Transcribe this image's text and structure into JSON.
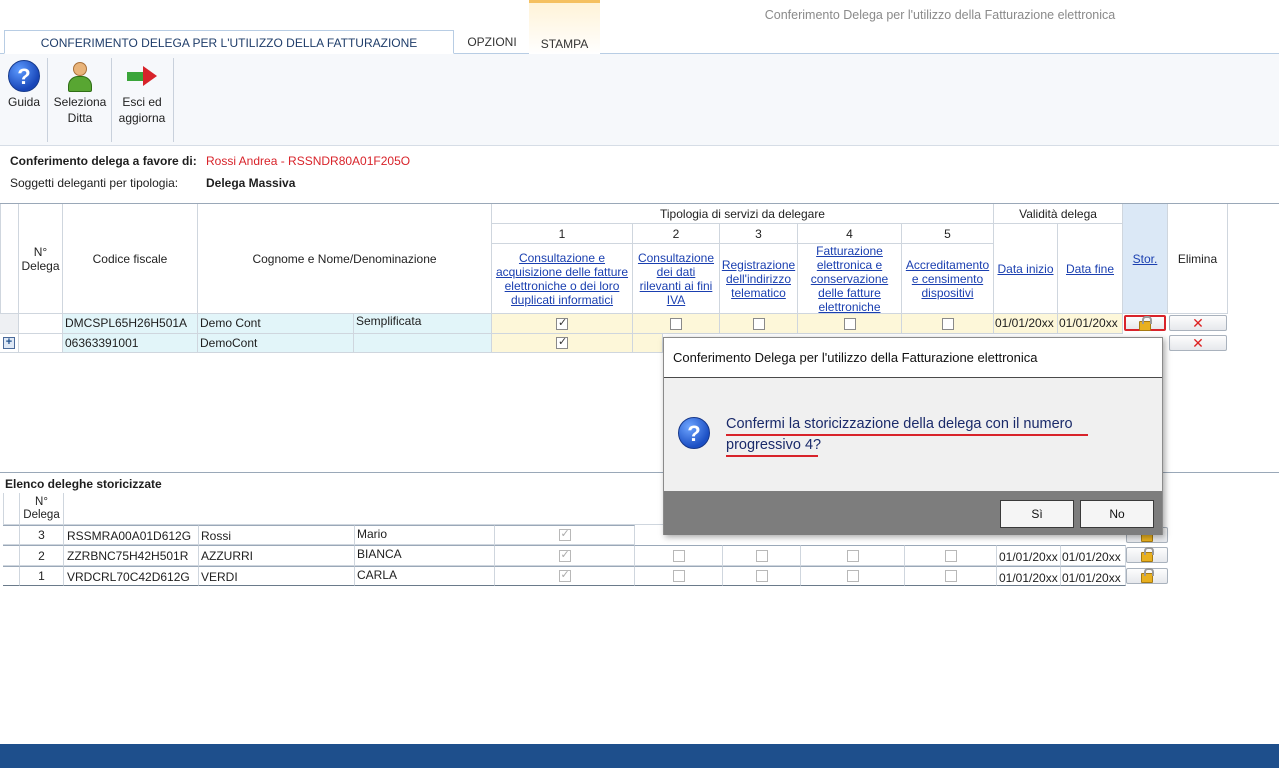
{
  "window_title": "Conferimento Delega per l'utilizzo della Fatturazione elettronica",
  "tabs": [
    "CONFERIMENTO DELEGA PER L'UTILIZZO DELLA FATTURAZIONE ELETTRONICA",
    "OPZIONI",
    "STAMPA"
  ],
  "ribbon": {
    "guida": "Guida",
    "seleziona_1": "Seleziona",
    "seleziona_2": "Ditta",
    "esci_1": "Esci ed",
    "esci_2": "aggiorna"
  },
  "info": {
    "favore_label": "Conferimento delega a favore di:",
    "favore_value": "Rossi Andrea - RSSNDR80A01F205O",
    "soggetti_label": "Soggetti deleganti per tipologia:",
    "soggetti_value": "Delega Massiva"
  },
  "grid": {
    "group_tipologia": "Tipologia di servizi da delegare",
    "group_validita": "Validità delega",
    "col_n": "N° Delega",
    "col_cf": "Codice fiscale",
    "col_nome": "Cognome e Nome/Denominazione",
    "nums": [
      "1",
      "2",
      "3",
      "4",
      "5"
    ],
    "services": [
      "Consultazione e acquisizione delle fatture elettroniche o dei loro duplicati informatici",
      "Consultazione dei dati rilevanti ai fini IVA",
      "Registrazione dell'indirizzo telematico",
      "Fatturazione elettronica e conservazione delle fatture elettroniche",
      "Accreditamento e censimento dispositivi"
    ],
    "data_inizio": "Data inizio",
    "data_fine": "Data fine",
    "stor": "Stor.",
    "elimina": "Elimina",
    "rows": [
      {
        "cf": "DMCSPL65H26H501A",
        "nome": "Demo Cont",
        "regime": "Semplificata",
        "inizio": "01/01/20xx",
        "fine": "01/01/20xx"
      },
      {
        "cf": "06363391001",
        "nome": "DemoCont",
        "regime": "",
        "inizio": "",
        "fine": ""
      }
    ]
  },
  "storico": {
    "title": "Elenco deleghe storicizzate",
    "col_n": "N° Delega",
    "rows": [
      {
        "n": "3",
        "cf": "RSSMRA00A01D612G",
        "cognome": "Rossi",
        "nome": "Mario",
        "inizio": "",
        "fine": ""
      },
      {
        "n": "2",
        "cf": "ZZRBNC75H42H501R",
        "cognome": "AZZURRI",
        "nome": "BIANCA",
        "inizio": "01/01/20xx",
        "fine": "01/01/20xx"
      },
      {
        "n": "1",
        "cf": "VRDCRL70C42D612G",
        "cognome": "VERDI",
        "nome": "CARLA",
        "inizio": "01/01/20xx",
        "fine": "01/01/20xx"
      }
    ]
  },
  "dialog": {
    "title": "Conferimento Delega per l'utilizzo della Fatturazione elettronica",
    "line1": "Confermi la storicizzazione della delega con il numero",
    "line2": "progressivo 4?",
    "yes": "Sì",
    "no": "No"
  },
  "colors": {
    "accent": "#1e4f8c",
    "link": "#1a3fb0",
    "error": "#d8232a"
  }
}
